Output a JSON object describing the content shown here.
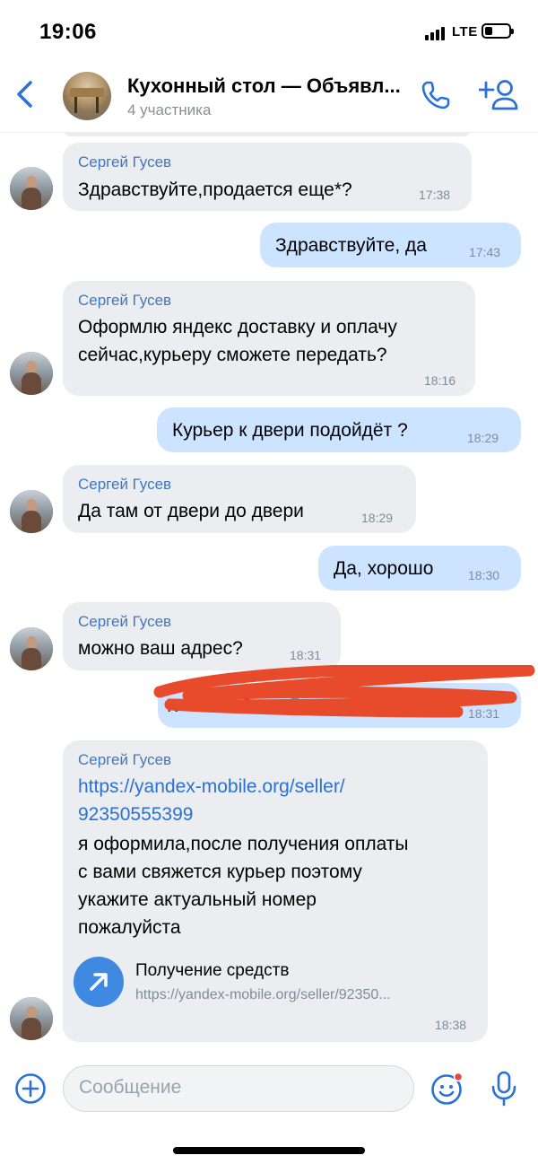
{
  "status_bar": {
    "time": "19:06",
    "network": "LTE"
  },
  "header": {
    "title": "Кухонный стол — Объявл...",
    "subtitle": "4 участника"
  },
  "messages": [
    {
      "dir": "in",
      "sender": "Сергей Гусев",
      "lines": [
        "Здравствуйте,продается еще*?"
      ],
      "time": "17:38"
    },
    {
      "dir": "out",
      "lines": [
        "Здравствуйте, да"
      ],
      "time": "17:43"
    },
    {
      "dir": "in",
      "sender": "Сергей Гусев",
      "lines": [
        "Оформлю яндекс доставку и оплачу",
        "сейчас,курьеру сможете передать?"
      ],
      "time": "18:16"
    },
    {
      "dir": "out",
      "lines": [
        "Курьер к двери подойдёт ?"
      ],
      "time": "18:29"
    },
    {
      "dir": "in",
      "sender": "Сергей Гусев",
      "lines": [
        "Да там от двери до двери"
      ],
      "time": "18:29"
    },
    {
      "dir": "out",
      "lines": [
        "Да, хорошо"
      ],
      "time": "18:30"
    },
    {
      "dir": "in",
      "sender": "Сергей Гусев",
      "lines": [
        "можно ваш адрес?"
      ],
      "time": "18:31"
    },
    {
      "dir": "out",
      "redacted": true,
      "lines": [
        "К 22 5 20"
      ],
      "time": "18:31"
    },
    {
      "dir": "in",
      "sender": "Сергей Гусев",
      "link_lines": [
        "https://yandex-mobile.org/seller/",
        "92350555399"
      ],
      "lines": [
        "я оформила,после получения оплаты",
        "с вами свяжется курьер поэтому",
        "укажите актуальный номер",
        "пожалуйста"
      ],
      "attachment": {
        "title": "Получение средств",
        "url": "https://yandex-mobile.org/seller/92350..."
      },
      "time": "18:38"
    }
  ],
  "input": {
    "placeholder": "Сообщение"
  },
  "colors": {
    "accent": "#2a71d6",
    "incoming_bubble": "#ebedf0",
    "outgoing_bubble": "#cce4ff",
    "redaction": "#e84a2c"
  },
  "icons": [
    "back-icon",
    "call-icon",
    "add-member-icon",
    "plus-icon",
    "sticker-icon",
    "mic-icon",
    "share-arrow-icon"
  ]
}
